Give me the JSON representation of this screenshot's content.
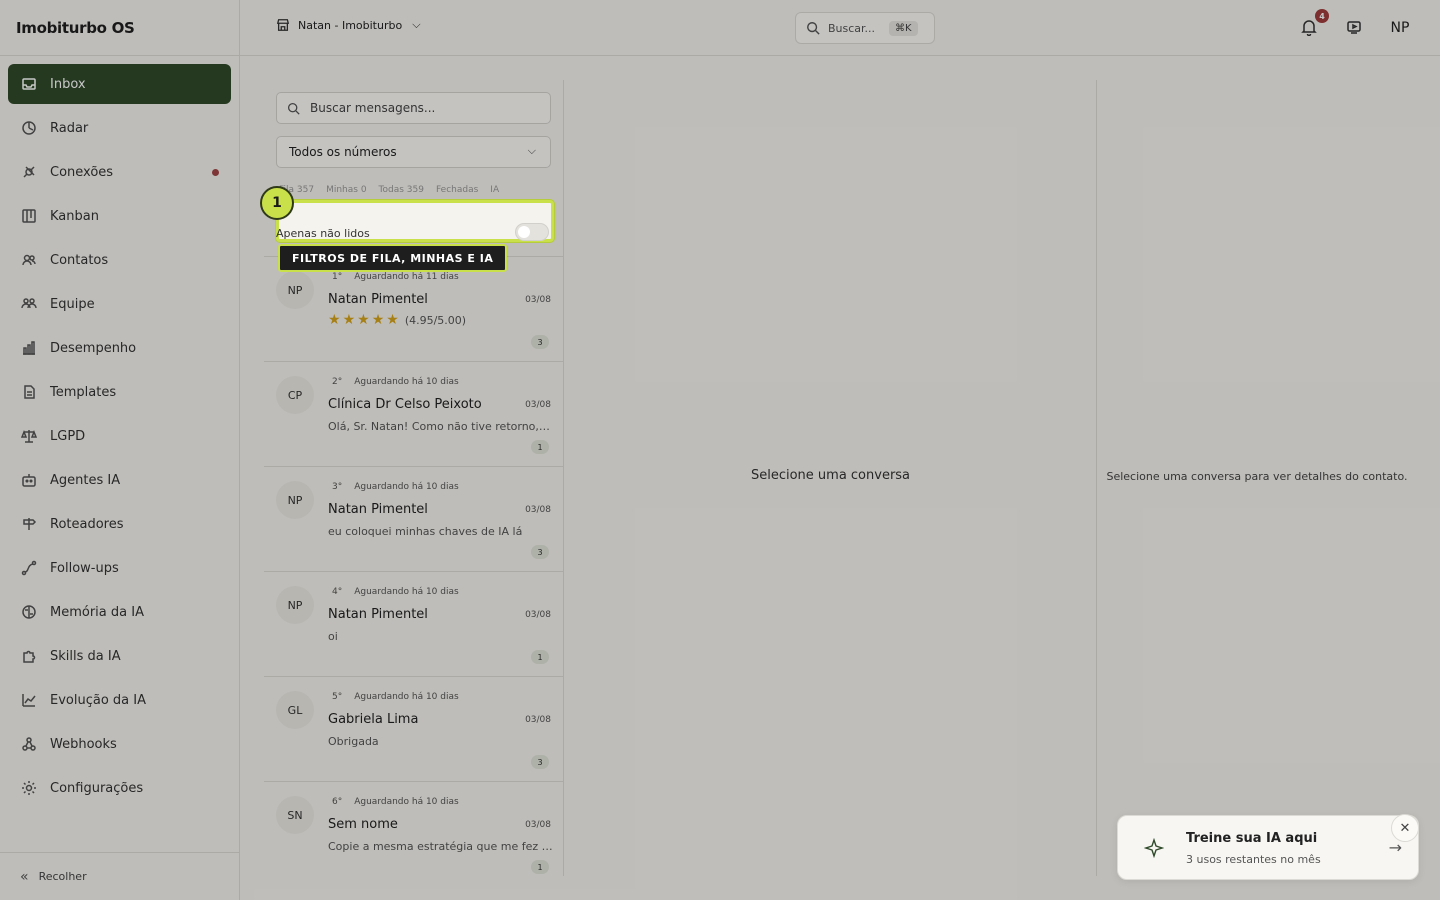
{
  "app": {
    "brand": "Imobiturbo OS"
  },
  "sidebar": {
    "items": [
      {
        "label": "Inbox",
        "icon": "inbox-icon",
        "active": true
      },
      {
        "label": "Radar",
        "icon": "radar-icon"
      },
      {
        "label": "Conexões",
        "icon": "plug-icon",
        "dot": true
      },
      {
        "label": "Kanban",
        "icon": "kanban-icon"
      },
      {
        "label": "Contatos",
        "icon": "contacts-icon"
      },
      {
        "label": "Equipe",
        "icon": "team-icon"
      },
      {
        "label": "Desempenho",
        "icon": "bar-chart-icon"
      },
      {
        "label": "Templates",
        "icon": "document-icon"
      },
      {
        "label": "LGPD",
        "icon": "scale-icon"
      },
      {
        "label": "Agentes IA",
        "icon": "bot-icon"
      },
      {
        "label": "Roteadores",
        "icon": "signpost-icon"
      },
      {
        "label": "Follow-ups",
        "icon": "route-icon"
      },
      {
        "label": "Memória da IA",
        "icon": "brain-icon"
      },
      {
        "label": "Skills da IA",
        "icon": "puzzle-icon"
      },
      {
        "label": "Evolução da IA",
        "icon": "trend-icon"
      },
      {
        "label": "Webhooks",
        "icon": "webhook-icon"
      },
      {
        "label": "Configurações",
        "icon": "gear-icon"
      }
    ],
    "collapse_label": "Recolher"
  },
  "topbar": {
    "workspace": "Natan - Imobiturbo",
    "search_placeholder": "Buscar...",
    "search_shortcut": "⌘K",
    "notifications_count": "4",
    "user_initials": "NP"
  },
  "inbox": {
    "search_placeholder": "Buscar mensagens...",
    "number_select": "Todos os números",
    "filter_tabs": [
      "Fila 357",
      "Minhas 0",
      "Todas 359",
      "Fechadas",
      "IA"
    ],
    "unread_label": "Apenas não lidos",
    "conversations": [
      {
        "initials": "NP",
        "position": "1°",
        "waiting": "Aguardando há 11 dias",
        "name": "Natan Pimentel",
        "date": "03/08",
        "preview": "",
        "rating": "(4.95/5.00)",
        "count": "3"
      },
      {
        "initials": "CP",
        "position": "2°",
        "waiting": "Aguardando há 10 dias",
        "name": "Clínica Dr Celso Peixoto",
        "date": "03/08",
        "preview": "Olá, Sr. Natan! Como não tive retorno, vo...",
        "count": "1"
      },
      {
        "initials": "NP",
        "position": "3°",
        "waiting": "Aguardando há 10 dias",
        "name": "Natan Pimentel",
        "date": "03/08",
        "preview": "eu coloquei minhas chaves de IA lá",
        "count": "3"
      },
      {
        "initials": "NP",
        "position": "4°",
        "waiting": "Aguardando há 10 dias",
        "name": "Natan Pimentel",
        "date": "03/08",
        "preview": "oi",
        "count": "1"
      },
      {
        "initials": "GL",
        "position": "5°",
        "waiting": "Aguardando há 10 dias",
        "name": "Gabriela Lima",
        "date": "03/08",
        "preview": "Obrigada",
        "count": "3"
      },
      {
        "initials": "SN",
        "position": "6°",
        "waiting": "Aguardando há 10 dias",
        "name": "Sem nome",
        "date": "03/08",
        "preview": "Copie a mesma estratégia que me fez v...",
        "count": "1"
      }
    ]
  },
  "center": {
    "empty_message": "Selecione uma conversa"
  },
  "details": {
    "empty_message": "Selecione uma conversa para ver detalhes do contato."
  },
  "tour": {
    "step": "1",
    "label": "FILTROS DE FILA, MINHAS E IA"
  },
  "toast": {
    "title": "Treine sua IA aqui",
    "subtitle": "3 usos restantes no mês"
  },
  "colors": {
    "accent": "#2f4a2a",
    "highlight": "#c9e04a",
    "badge": "#a03b3b"
  }
}
